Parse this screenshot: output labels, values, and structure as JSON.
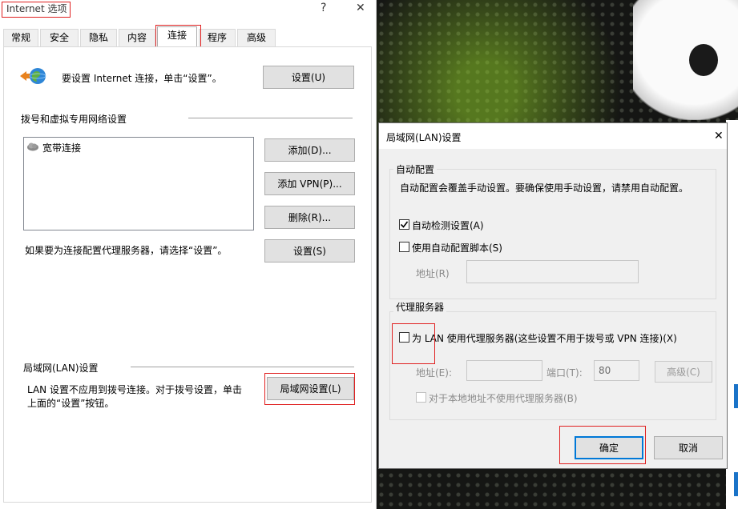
{
  "ie_window": {
    "title": "Internet 选项",
    "help_label": "?",
    "close_label": "✕",
    "tabs": [
      {
        "label": "常规"
      },
      {
        "label": "安全"
      },
      {
        "label": "隐私"
      },
      {
        "label": "内容"
      },
      {
        "label": "连接"
      },
      {
        "label": "程序"
      },
      {
        "label": "高级"
      }
    ],
    "active_tab": "连接",
    "setup_text": "要设置 Internet 连接，单击“设置”。",
    "setup_button": "设置(U)",
    "dialup_heading": "拨号和虚拟专用网络设置",
    "connections": [
      {
        "label": "宽带连接"
      }
    ],
    "add_button": "添加(D)...",
    "add_vpn_button": "添加 VPN(P)...",
    "remove_button": "删除(R)...",
    "proxy_hint": "如果要为连接配置代理服务器，请选择“设置”。",
    "settings_button": "设置(S)",
    "lan_heading": "局域网(LAN)设置",
    "lan_text_line1": "LAN 设置不应用到拨号连接。对于拨号设置，单击",
    "lan_text_line2": "上面的“设置”按钮。",
    "lan_button": "局域网设置(L)"
  },
  "lan_dialog": {
    "title": "局域网(LAN)设置",
    "close_label": "✕",
    "auto_group_title": "自动配置",
    "auto_desc": "自动配置会覆盖手动设置。要确保使用手动设置，请禁用自动配置。",
    "auto_detect_label": "自动检测设置(A)",
    "auto_detect_checked": true,
    "auto_script_label": "使用自动配置脚本(S)",
    "auto_script_checked": false,
    "address_label": "地址(R)",
    "address_value": "",
    "proxy_group_title": "代理服务器",
    "use_proxy_label": "为 LAN 使用代理服务器(这些设置不用于拨号或 VPN 连接)(X)",
    "use_proxy_checked": false,
    "proxy_address_label": "地址(E):",
    "proxy_address_value": "",
    "port_label": "端口(T):",
    "port_value": "80",
    "advanced_button": "高级(C)",
    "bypass_local_label": "对于本地地址不使用代理服务器(B)",
    "bypass_local_checked": false,
    "ok_button": "确定",
    "cancel_button": "取消"
  },
  "colors": {
    "highlight_box": "#e02020",
    "primary_border": "#0078d7"
  }
}
